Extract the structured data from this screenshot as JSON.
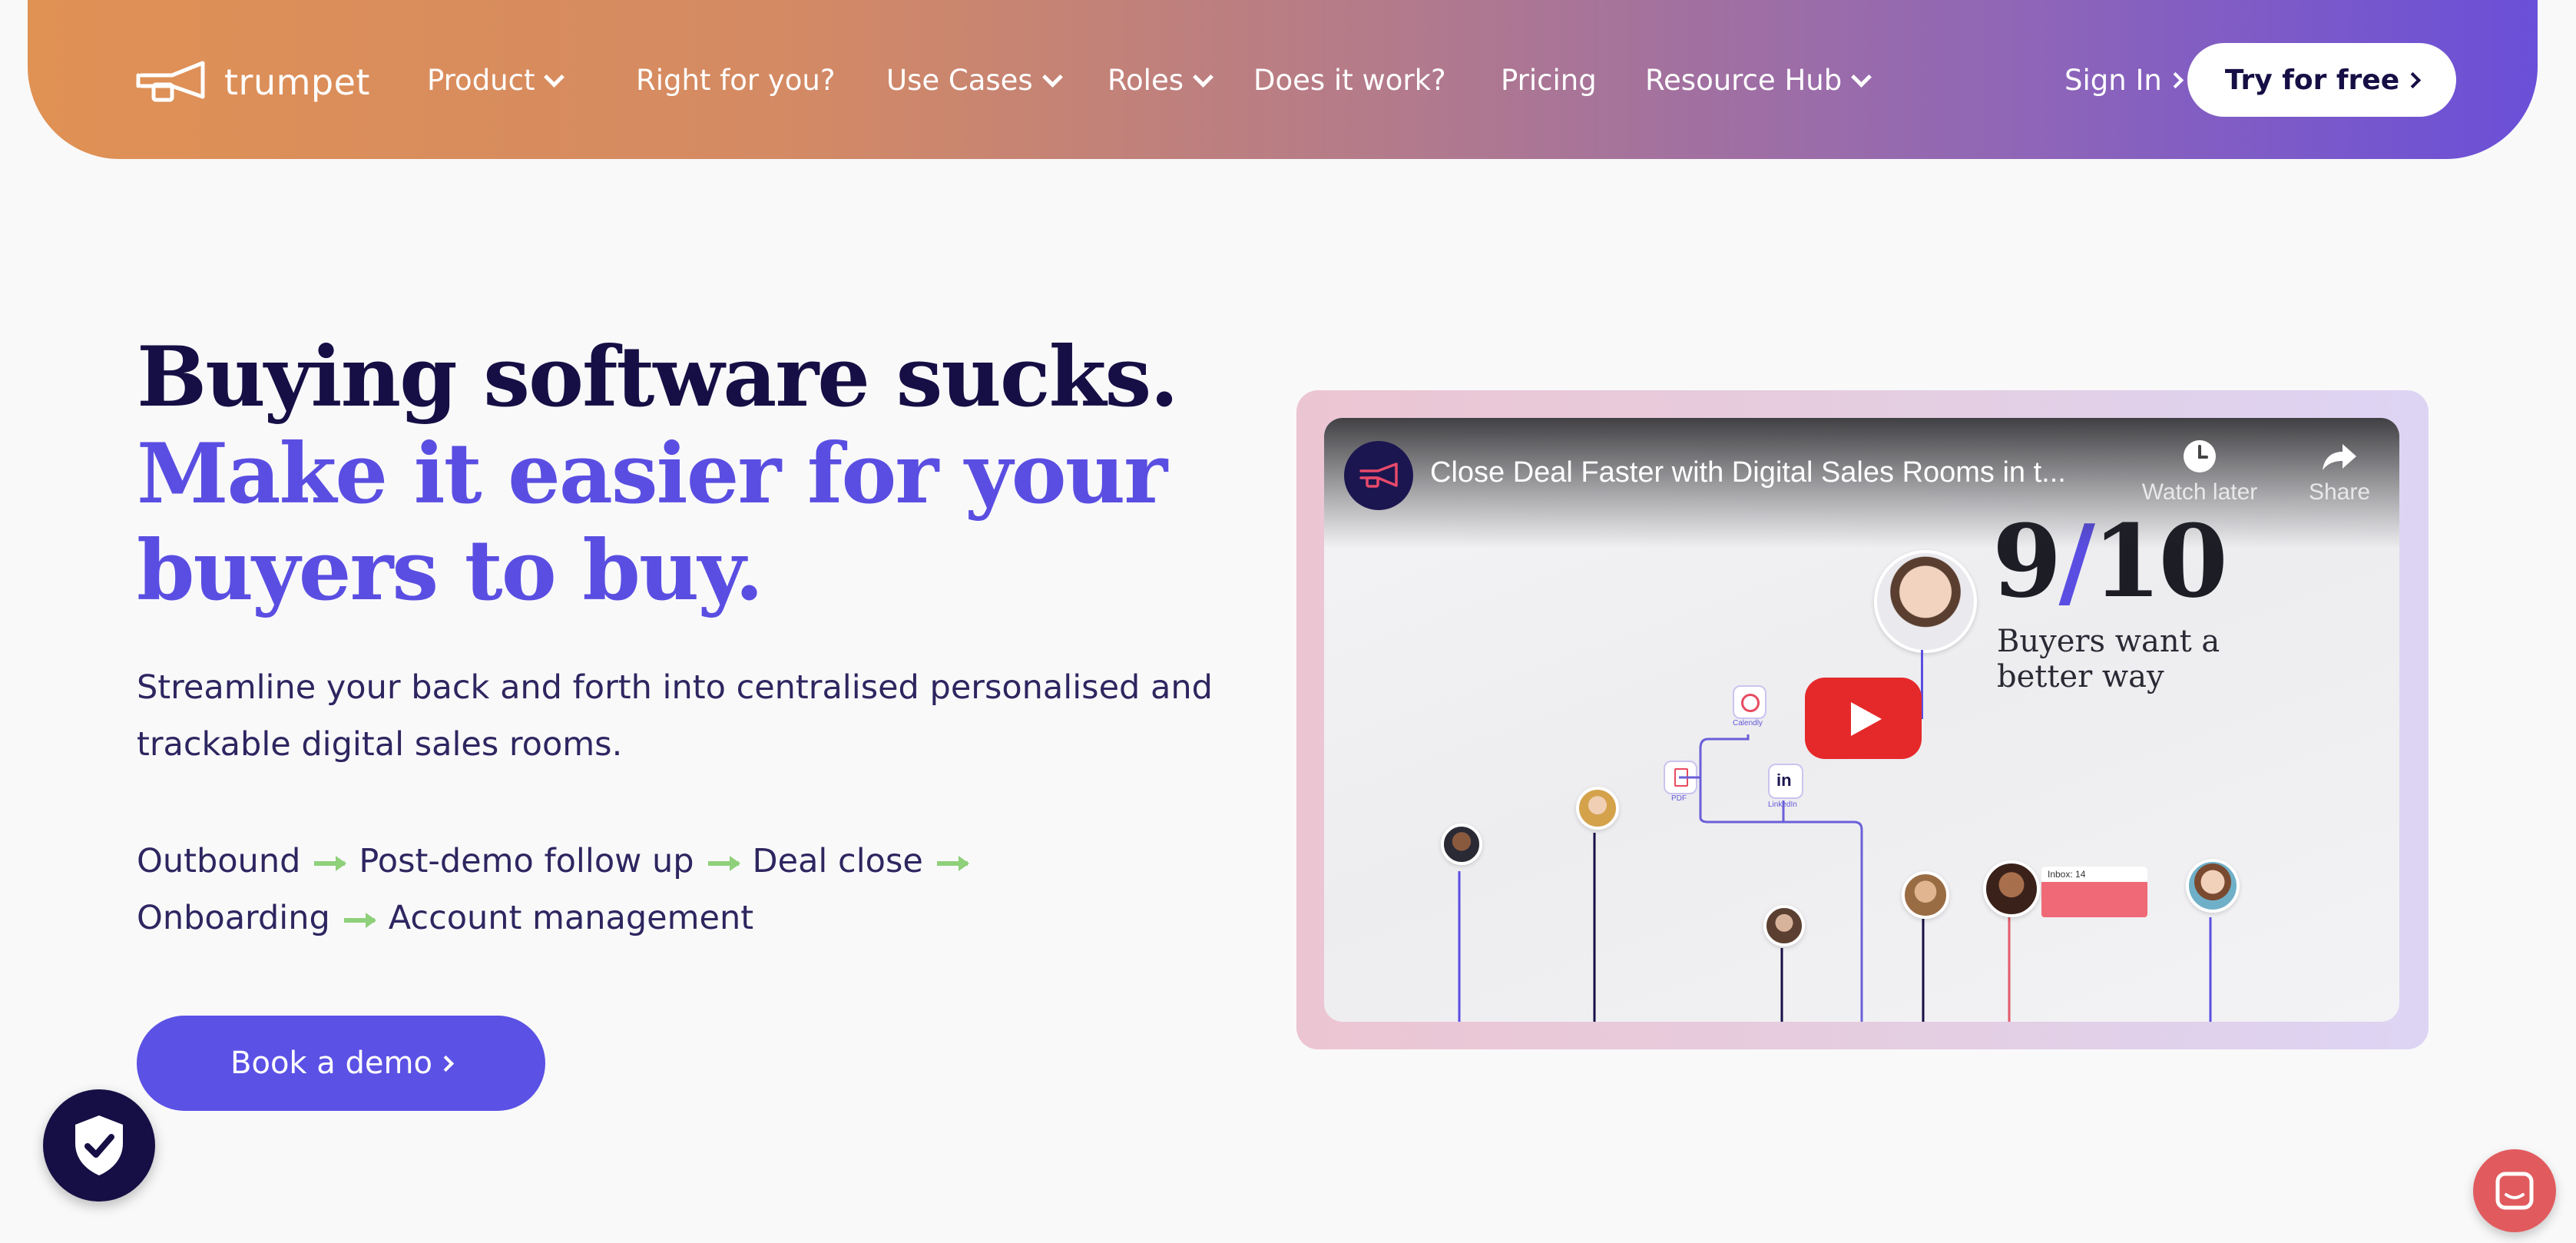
{
  "brand": {
    "name": "trumpet"
  },
  "nav": {
    "items": [
      {
        "label": "Product",
        "dropdown": true
      },
      {
        "label": "Right for you?",
        "dropdown": false
      },
      {
        "label": "Use Cases",
        "dropdown": true
      },
      {
        "label": "Roles",
        "dropdown": true
      },
      {
        "label": "Does it work?",
        "dropdown": false
      },
      {
        "label": "Pricing",
        "dropdown": false
      },
      {
        "label": "Resource Hub",
        "dropdown": true
      }
    ],
    "sign_in": "Sign In",
    "try_free": "Try for free"
  },
  "hero": {
    "headline_line1": "Buying software sucks.",
    "headline_line2": "Make it easier for your buyers to buy.",
    "subtext": "Streamline your back and forth into centralised  personalised and trackable digital sales rooms.",
    "steps": [
      "Outbound",
      "Post-demo follow up",
      "Deal close",
      "Onboarding",
      "Account management"
    ],
    "cta": "Book a demo"
  },
  "video": {
    "title": "Close Deal Faster with Digital Sales Rooms in t...",
    "watch_later": "Watch later",
    "share": "Share",
    "stat": "9/10",
    "stat_caption": "Buyers want a better way",
    "chip_labels": [
      "Calendly",
      "PDF",
      "LinkedIn"
    ],
    "inbox_label": "Inbox: 14"
  },
  "colors": {
    "nav_gradient_start": "#e09154",
    "nav_gradient_end": "#6a4fd8",
    "heading_dark": "#160f45",
    "heading_accent": "#5a4ee2",
    "cta_purple": "#5b51e5",
    "arrow_green": "#8fd07a",
    "youtube_red": "#e5292a",
    "chat_red": "#e15b5e"
  },
  "icons": [
    "trumpet-logo-icon",
    "chevron-down-icon",
    "chevron-right-icon",
    "clock-icon",
    "share-icon",
    "play-icon",
    "shield-check-icon",
    "chat-icon"
  ]
}
